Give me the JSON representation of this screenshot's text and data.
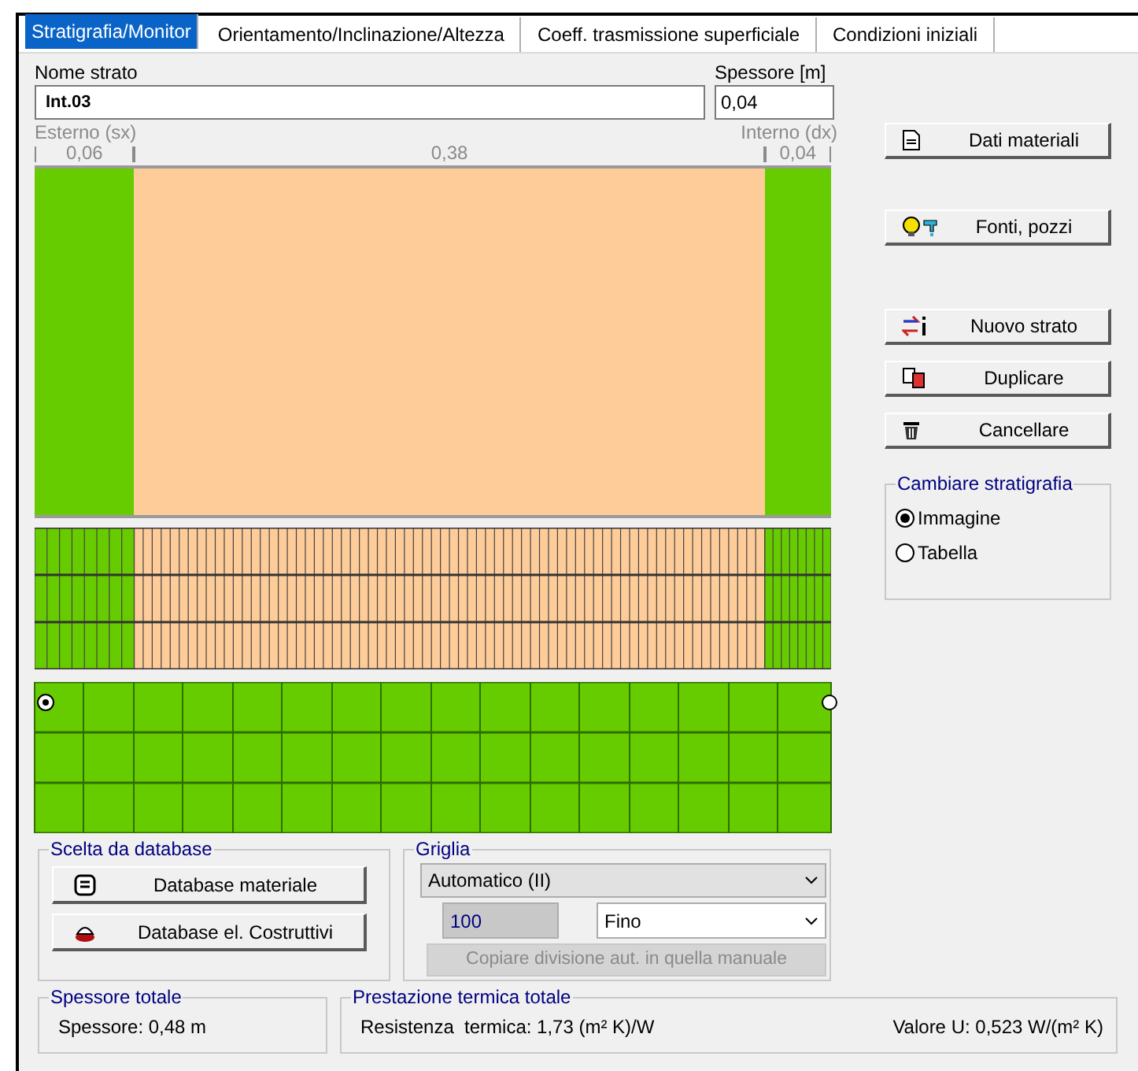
{
  "tabs": [
    {
      "label": "Stratigrafia/Monitor",
      "selected": true
    },
    {
      "label": "Orientamento/Inclinazione/Altezza",
      "selected": false
    },
    {
      "label": "Coeff. trasmissione superficiale",
      "selected": false
    },
    {
      "label": "Condizioni iniziali",
      "selected": false
    }
  ],
  "layer_name": {
    "label": "Nome strato",
    "value": "Int.03"
  },
  "thickness": {
    "label": "Spessore [m]",
    "value": "0,04"
  },
  "sides": {
    "outside": "Esterno (sx)",
    "inside": "Interno (dx)"
  },
  "layers": [
    {
      "thickness": "0,06",
      "color": "#66cc00"
    },
    {
      "thickness": "0,38",
      "color": "#fecc99"
    },
    {
      "thickness": "0,04",
      "color": "#66cc00"
    }
  ],
  "buttons": [
    {
      "label": "Dati materiali",
      "kind": "document"
    },
    {
      "label": "Fonti, pozzi",
      "kind": "source"
    },
    {
      "label": "Nuovo strato",
      "kind": "new"
    },
    {
      "label": "Duplicare",
      "kind": "copy"
    },
    {
      "label": "Cancellare",
      "kind": "trash"
    }
  ],
  "view_group": {
    "title": "Cambiare stratigrafia",
    "options": [
      {
        "label": "Immagine",
        "selected": true
      },
      {
        "label": "Tabella",
        "selected": false
      }
    ]
  },
  "database_group": {
    "title": "Scelta da database",
    "buttons": [
      {
        "label": "Database materiale",
        "kind": "bin"
      },
      {
        "label": "Database el. Costruttivi",
        "kind": "kettle"
      }
    ]
  },
  "grid_group": {
    "title": "Griglia",
    "mode": "Automatico (II)",
    "count": "100",
    "fineness": "Fino",
    "copy_button": {
      "label": "Copiare divisione aut. in quella manuale",
      "disabled": true
    }
  },
  "total_thickness": {
    "title": "Spessore totale",
    "text": "Spessore: 0,48 m"
  },
  "thermal": {
    "title": "Prestazione termica totale",
    "resistance": "Resistenza  termica: 1,73 (m² K)/W",
    "u_value": "Valore U: 0,523 W/(m² K)"
  }
}
